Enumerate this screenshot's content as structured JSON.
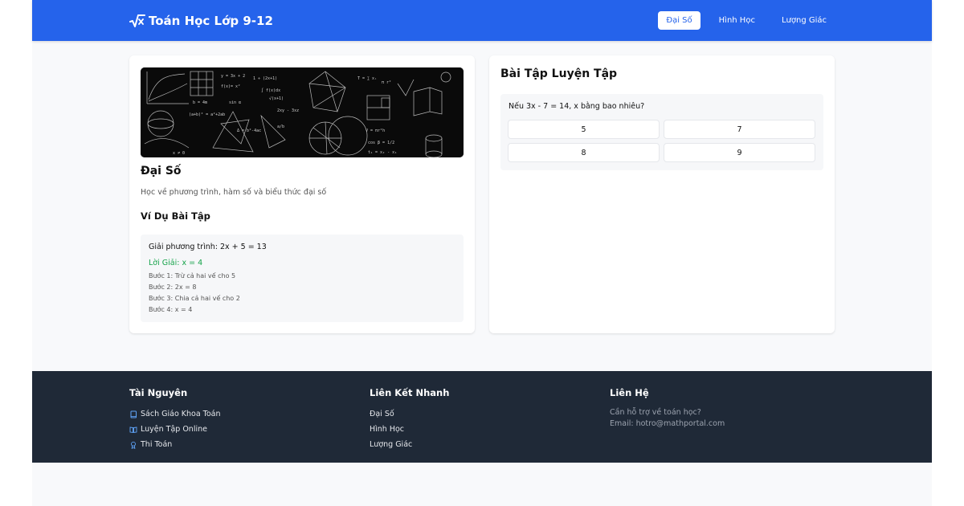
{
  "header": {
    "title": "Toán Học Lớp 9-12",
    "logo_icon": "square-root-x-icon",
    "nav": [
      {
        "label": "Đại Số",
        "active": true
      },
      {
        "label": "Hình Học",
        "active": false
      },
      {
        "label": "Lượng Giác",
        "active": false
      }
    ]
  },
  "lesson": {
    "title": "Đại Số",
    "description": "Học về phương trình, hàm số và biểu thức đại số",
    "example_heading": "Ví Dụ Bài Tập",
    "example": {
      "question": "Giải phương trình: 2x + 5 = 13",
      "answer": "Lời Giải: x = 4",
      "steps": [
        "Bước 1: Trừ cả hai vế cho 5",
        "Bước 2: 2x = 8",
        "Bước 3: Chia cả hai vế cho 2",
        "Bước 4: x = 4"
      ]
    }
  },
  "practice": {
    "title": "Bài Tập Luyện Tập",
    "question": "Nếu 3x - 7 = 14, x bằng bao nhiêu?",
    "options": [
      "5",
      "7",
      "8",
      "9"
    ]
  },
  "footer": {
    "resources": {
      "heading": "Tài Nguyên",
      "items": [
        {
          "label": "Sách Giáo Khoa Toán",
          "icon": "book-icon"
        },
        {
          "label": "Luyện Tập Online",
          "icon": "open-book-icon"
        },
        {
          "label": "Thi Toán",
          "icon": "award-icon"
        }
      ]
    },
    "links": {
      "heading": "Liên Kết Nhanh",
      "items": [
        "Đại Số",
        "Hình Học",
        "Lượng Giác"
      ]
    },
    "contact": {
      "heading": "Liên Hệ",
      "lines": [
        "Cần hỗ trợ về toán học?",
        "Email: hotro@mathportal.com"
      ]
    }
  },
  "colors": {
    "primary": "#2563eb",
    "footer_bg": "#1f2937",
    "success": "#16a34a",
    "icon_accent": "#60a5fa"
  }
}
